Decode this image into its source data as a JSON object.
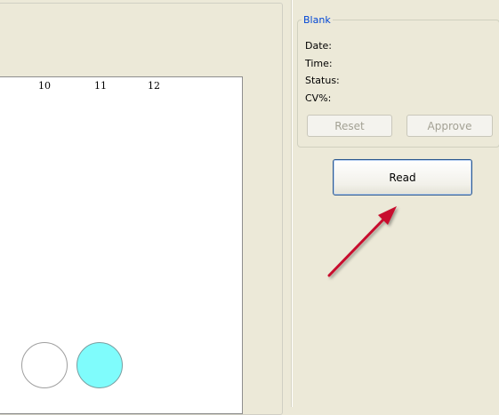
{
  "plate": {
    "column_labels": [
      "10",
      "11",
      "12"
    ],
    "wells": [
      {
        "name": "well-empty",
        "fill": "#ffffff"
      },
      {
        "name": "well-filled",
        "fill": "#7ffcfc"
      }
    ]
  },
  "blank_panel": {
    "legend": "Blank",
    "fields": {
      "date_label": "Date:",
      "time_label": "Time:",
      "status_label": "Status:",
      "cv_label": "CV%:"
    },
    "reset_label": "Reset",
    "approve_label": "Approve"
  },
  "read_button": {
    "label": "Read"
  },
  "colors": {
    "legend": "#0046d5",
    "arrow": "#c8102e",
    "background": "#ece9d8",
    "filled_well": "#7ffcfc"
  }
}
